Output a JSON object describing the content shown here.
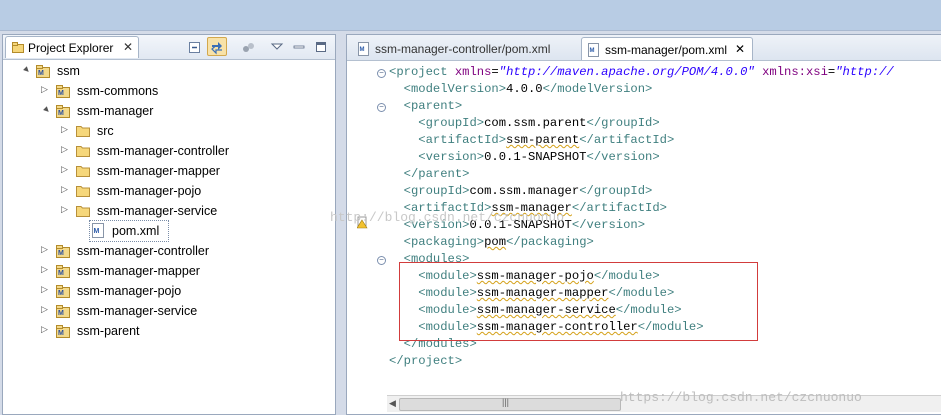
{
  "explorer": {
    "tab_label": "Project Explorer",
    "close_glyph": "✕",
    "items": [
      {
        "label": "ssm",
        "icon": "maven-project-icon",
        "twisty": "▲"
      },
      {
        "label": "ssm-commons",
        "icon": "maven-project-icon",
        "twisty": "▷"
      },
      {
        "label": "ssm-manager",
        "icon": "maven-project-icon",
        "twisty": "▲"
      },
      {
        "label": "src",
        "icon": "folder-icon",
        "twisty": "▷"
      },
      {
        "label": "ssm-manager-controller",
        "icon": "folder-icon",
        "twisty": "▷"
      },
      {
        "label": "ssm-manager-mapper",
        "icon": "folder-icon",
        "twisty": "▷"
      },
      {
        "label": "ssm-manager-pojo",
        "icon": "folder-icon",
        "twisty": "▷"
      },
      {
        "label": "ssm-manager-service",
        "icon": "folder-icon",
        "twisty": "▷"
      },
      {
        "label": "pom.xml",
        "icon": "xml-file-icon",
        "twisty": ""
      },
      {
        "label": "ssm-manager-controller",
        "icon": "maven-project-icon",
        "twisty": "▷"
      },
      {
        "label": "ssm-manager-mapper",
        "icon": "maven-project-icon",
        "twisty": "▷"
      },
      {
        "label": "ssm-manager-pojo",
        "icon": "maven-project-icon",
        "twisty": "▷"
      },
      {
        "label": "ssm-manager-service",
        "icon": "maven-project-icon",
        "twisty": "▷"
      },
      {
        "label": "ssm-parent",
        "icon": "maven-project-icon",
        "twisty": "▷"
      }
    ]
  },
  "editor": {
    "tabs": [
      {
        "label": "ssm-manager-controller/pom.xml",
        "active": false
      },
      {
        "label": "ssm-manager/pom.xml",
        "active": true,
        "close_glyph": "✕"
      }
    ],
    "lines": [
      "<project xmlns=\"http://maven.apache.org/POM/4.0.0\" xmlns:xsi=\"http://",
      "  <modelVersion>4.0.0</modelVersion>",
      "  <parent>",
      "    <groupId>com.ssm.parent</groupId>",
      "    <artifactId>ssm-parent</artifactId>",
      "    <version>0.0.1-SNAPSHOT</version>",
      "  </parent>",
      "  <groupId>com.ssm.manager</groupId>",
      "  <artifactId>ssm-manager</artifactId>",
      "  <version>0.0.1-SNAPSHOT</version>",
      "  <packaging>pom</packaging>",
      "  <modules>",
      "    <module>ssm-manager-pojo</module>",
      "    <module>ssm-manager-mapper</module>",
      "    <module>ssm-manager-service</module>",
      "    <module>ssm-manager-controller</module>",
      "  </modules>",
      "</project>"
    ],
    "scroll_glyph": "|||"
  },
  "watermarks": {
    "center": "http://blog.csdn.net/czcnuonuo",
    "bottom_right": "https://blog.csdn.net/czcnuonuo"
  },
  "colors": {
    "tag": "#3f7f7f",
    "attribute": "#7f007f",
    "string": "#2a00ff",
    "highlight_box": "#d23c3c"
  }
}
